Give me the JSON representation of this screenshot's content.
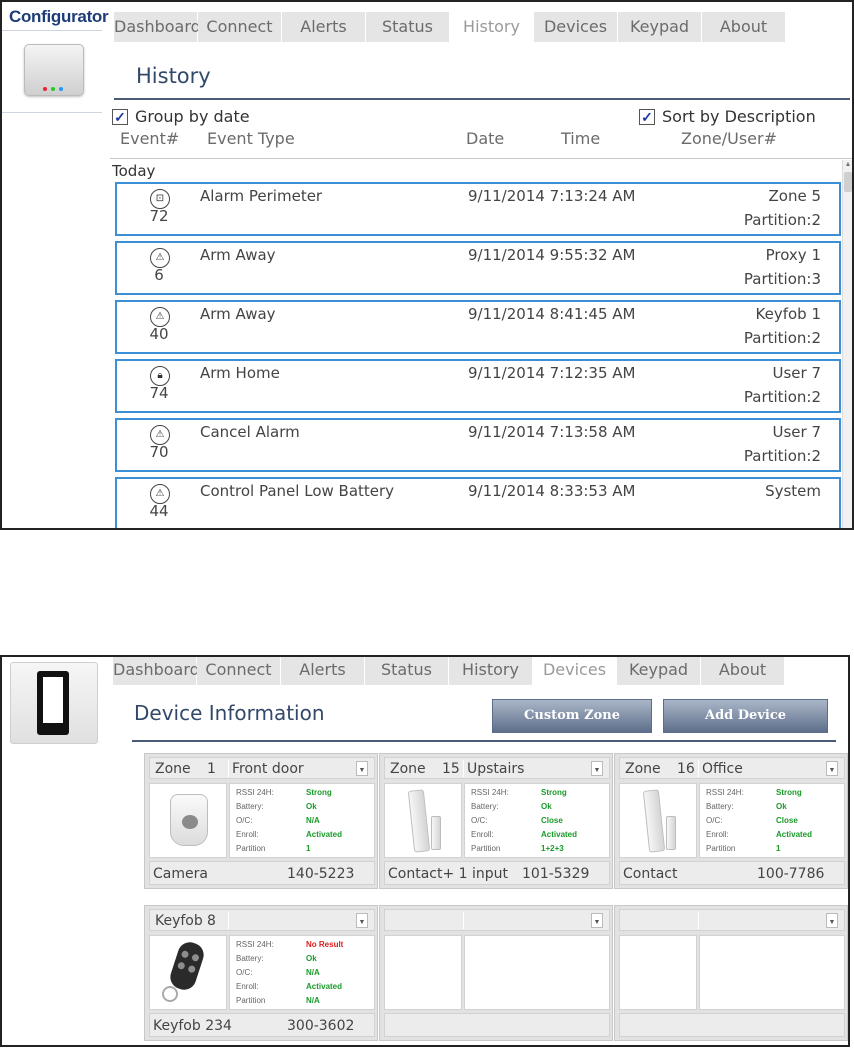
{
  "history_panel": {
    "app_title": "Configurator",
    "tabs": [
      {
        "label": "Dashboard",
        "active": false
      },
      {
        "label": "Connect",
        "active": false
      },
      {
        "label": "Alerts",
        "active": false
      },
      {
        "label": "Status",
        "active": false
      },
      {
        "label": "History",
        "active": true
      },
      {
        "label": "Devices",
        "active": false
      },
      {
        "label": "Keypad",
        "active": false
      },
      {
        "label": "About",
        "active": false
      }
    ],
    "page_title": "History",
    "group_by_date": {
      "label": "Group by date",
      "checked": true
    },
    "sort_by_description": {
      "label": "Sort by Description",
      "checked": true
    },
    "columns": {
      "event_num": "Event#",
      "event_type": "Event Type",
      "date": "Date",
      "time": "Time",
      "zone_user": "Zone/User#"
    },
    "group_label": "Today",
    "events": [
      {
        "icon": "perimeter-icon",
        "number": "72",
        "type": "Alarm Perimeter",
        "datetime": "9/11/2014 7:13:24 AM",
        "zone": "Zone 5",
        "partition": "Partition:2"
      },
      {
        "icon": "warning-icon",
        "number": "6",
        "type": "Arm Away",
        "datetime": "9/11/2014 9:55:32 AM",
        "zone": "Proxy 1",
        "partition": "Partition:3"
      },
      {
        "icon": "warning-icon",
        "number": "40",
        "type": "Arm Away",
        "datetime": "9/11/2014 8:41:45 AM",
        "zone": "Keyfob 1",
        "partition": "Partition:2"
      },
      {
        "icon": "lock-icon",
        "number": "74",
        "type": "Arm Home",
        "datetime": "9/11/2014 7:12:35 AM",
        "zone": "User 7",
        "partition": "Partition:2"
      },
      {
        "icon": "warning-icon",
        "number": "70",
        "type": "Cancel Alarm",
        "datetime": "9/11/2014 7:13:58 AM",
        "zone": "User 7",
        "partition": "Partition:2"
      },
      {
        "icon": "warning-icon",
        "number": "44",
        "type": "Control Panel Low Battery",
        "datetime": "9/11/2014 8:33:53 AM",
        "zone": "System",
        "partition": ""
      }
    ]
  },
  "devices_panel": {
    "tabs": [
      {
        "label": "Dashboard",
        "active": false
      },
      {
        "label": "Connect",
        "active": false
      },
      {
        "label": "Alerts",
        "active": false
      },
      {
        "label": "Status",
        "active": false
      },
      {
        "label": "History",
        "active": false
      },
      {
        "label": "Devices",
        "active": true
      },
      {
        "label": "Keypad",
        "active": false
      },
      {
        "label": "About",
        "active": false
      }
    ],
    "page_title": "Device Information",
    "buttons": {
      "custom_zone": "Custom Zone",
      "add_device": "Add Device"
    },
    "info_keys": [
      "RSSI 24H:",
      "Battery:",
      "O/C:",
      "Enroll:",
      "Partition"
    ],
    "cards": [
      {
        "zone_label": "Zone",
        "zone_num": "1",
        "name": "Front door",
        "rssi": "Strong",
        "battery": "Ok",
        "oc": "N/A",
        "enroll": "Activated",
        "partition": "1",
        "type": "Camera",
        "code": "140-5223",
        "image": "motion-camera-icon"
      },
      {
        "zone_label": "Zone",
        "zone_num": "15",
        "name": "Upstairs",
        "rssi": "Strong",
        "battery": "Ok",
        "oc": "Close",
        "enroll": "Activated",
        "partition": "1+2+3",
        "type": "Contact+ 1 input",
        "code": "101-5329",
        "image": "contact-sensor-icon"
      },
      {
        "zone_label": "Zone",
        "zone_num": "16",
        "name": "Office",
        "rssi": "Strong",
        "battery": "Ok",
        "oc": "Close",
        "enroll": "Activated",
        "partition": "1",
        "type": "Contact",
        "code": "100-7786",
        "image": "contact-sensor-icon"
      },
      {
        "zone_label": "Keyfob",
        "zone_num": "8",
        "name": "",
        "rssi": "No Result",
        "battery": "Ok",
        "oc": "N/A",
        "enroll": "Activated",
        "partition": "N/A",
        "type": "Keyfob 234",
        "code": "300-3602",
        "image": "keyfob-icon"
      }
    ],
    "colors": {
      "ok": "#1a9a2a",
      "bad": "#e01c1c",
      "row_border": "#3a8fd6",
      "title": "#33496b"
    }
  }
}
